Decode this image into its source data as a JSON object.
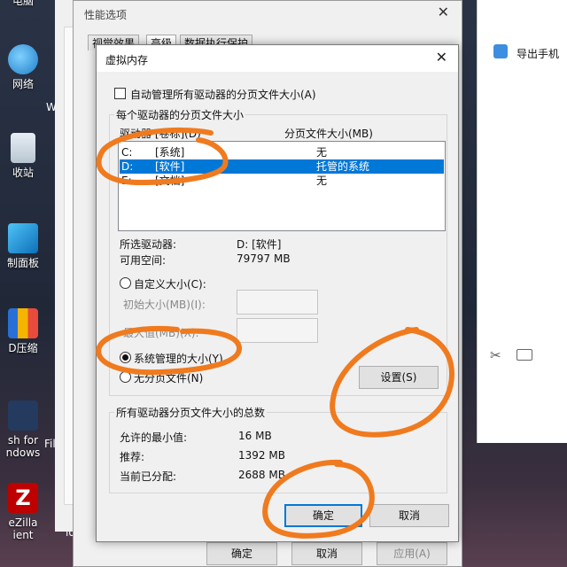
{
  "desktop": {
    "icons": [
      {
        "label": "电脑"
      },
      {
        "label": "网络"
      },
      {
        "label": "收站"
      },
      {
        "label": "制面板"
      },
      {
        "label": "D压缩"
      },
      {
        "label": "sh for\nndows"
      },
      {
        "label": "eZilla\nient"
      }
    ],
    "filezilla_label": "FileZill",
    "log_label": "log",
    "partial_w": "W"
  },
  "right_app": {
    "export_label": "导出手机"
  },
  "perf_window": {
    "title": "性能选项",
    "tabs": [
      "视觉效果",
      "高级",
      "数据执行保护"
    ],
    "buttons": {
      "ok": "确定",
      "cancel": "取消",
      "apply": "应用(A)"
    }
  },
  "dialog": {
    "title": "虚拟内存",
    "auto_manage_label": "自动管理所有驱动器的分页文件大小(A)",
    "auto_manage_checked": false,
    "group1_title": "每个驱动器的分页文件大小",
    "col_drive": "驱动器 [卷标](D)",
    "col_size": "分页文件大小(MB)",
    "drives": [
      {
        "letter": "C:",
        "label": "[系统]",
        "size": "无",
        "selected": false
      },
      {
        "letter": "D:",
        "label": "[软件]",
        "size": "托管的系统",
        "selected": true
      },
      {
        "letter": "E:",
        "label": "[文档]",
        "size": "无",
        "selected": false
      }
    ],
    "selected_drive_label": "所选驱动器:",
    "selected_drive_value": "D:  [软件]",
    "free_space_label": "可用空间:",
    "free_space_value": "79797 MB",
    "custom_size_label": "自定义大小(C):",
    "initial_size_label": "初始大小(MB)(I):",
    "max_size_label": "最大值(MB)(X):",
    "system_managed_label": "系统管理的大小(Y)",
    "no_paging_label": "无分页文件(N)",
    "set_button": "设置(S)",
    "group2_title": "所有驱动器分页文件大小的总数",
    "min_allowed_label": "允许的最小值:",
    "min_allowed_value": "16 MB",
    "recommended_label": "推荐:",
    "recommended_value": "1392 MB",
    "current_label": "当前已分配:",
    "current_value": "2688 MB",
    "ok_button": "确定",
    "cancel_button": "取消"
  },
  "colors": {
    "selection": "#0078d7",
    "annotation": "#f07a1e"
  }
}
